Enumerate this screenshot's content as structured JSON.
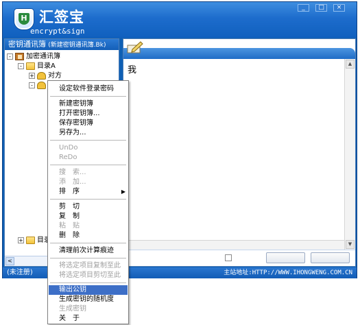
{
  "app": {
    "title": "汇签宝",
    "subtitle": "encrypt&sign",
    "logo_letter": "H",
    "controls": [
      "_",
      "□",
      "×"
    ]
  },
  "left_panel": {
    "header_title": "密钥通讯簿",
    "header_sub": "(新建密钥通讯簿.Bk)",
    "tree": [
      {
        "label": "加密通讯簿",
        "expander": "-",
        "icon": "address-book-icon"
      },
      {
        "label": "目录A",
        "expander": "-",
        "icon": "folder-icon"
      },
      {
        "label": "对方",
        "expander": "+",
        "icon": "keys-icon"
      },
      {
        "label": "我",
        "expander": "-",
        "icon": "keys-icon"
      },
      {
        "label": "目录",
        "expander": "+",
        "icon": "folder-icon"
      }
    ],
    "scroll_left": "<"
  },
  "right_panel": {
    "editor_text": "我",
    "scroll_up": "▲",
    "scroll_down": "▼"
  },
  "statusbar": {
    "left": "(未注册)",
    "right": "主站地址:HTTP://WWW.IHONGWENG.COM.CN"
  },
  "context_menu": {
    "items": [
      {
        "label": "设定软件登录密码",
        "disabled": false
      },
      {
        "label": "新建密钥簿",
        "disabled": false
      },
      {
        "label": "打开密钥簿...",
        "disabled": false
      },
      {
        "label": "保存密钥簿",
        "disabled": false
      },
      {
        "label": "另存为...",
        "disabled": false
      },
      {
        "label": "UnDo",
        "disabled": true
      },
      {
        "label": "ReDo",
        "disabled": true
      },
      {
        "label": "搜　索...",
        "disabled": true
      },
      {
        "label": "添　加...",
        "disabled": true
      },
      {
        "label": "排　序",
        "disabled": false,
        "submenu": "▶"
      },
      {
        "label": "剪　切",
        "disabled": false
      },
      {
        "label": "复　制",
        "disabled": false
      },
      {
        "label": "粘　贴",
        "disabled": true
      },
      {
        "label": "删　除",
        "disabled": false
      },
      {
        "label": "清理前次计算痕迹",
        "disabled": false
      },
      {
        "label": "将选定项目复制至此",
        "disabled": true
      },
      {
        "label": "将选定项目剪切至此",
        "disabled": true
      },
      {
        "label": "输出公钥",
        "disabled": false,
        "highlighted": true
      },
      {
        "label": "生成密钥的随机度",
        "disabled": false
      },
      {
        "label": "生成密钥",
        "disabled": true
      },
      {
        "label": "关　于",
        "disabled": false
      }
    ]
  },
  "colors": {
    "window_blue": "#0f5fb4",
    "menu_highlight": "#3d6fc7",
    "disabled_text": "#a0a0a0"
  }
}
